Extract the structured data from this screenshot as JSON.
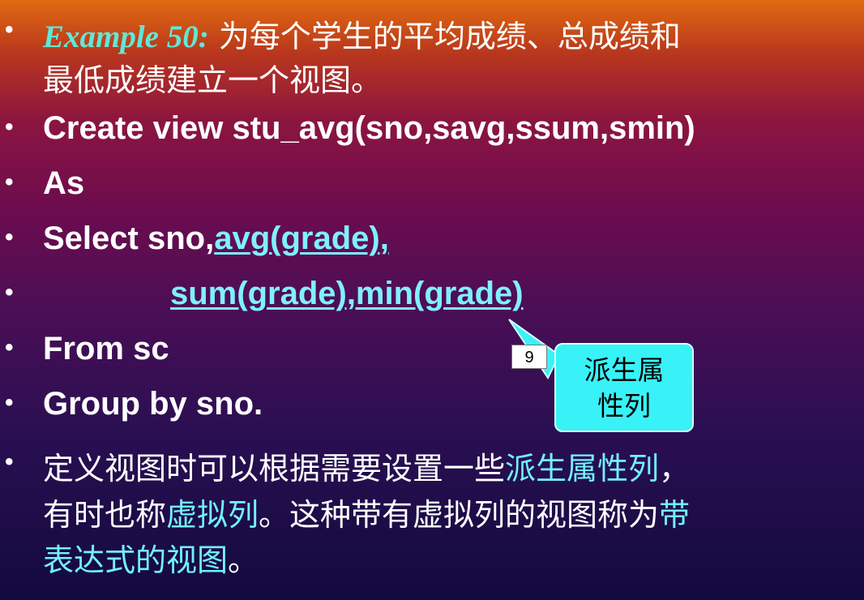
{
  "lines": {
    "l1_example": "Example 50:",
    "l1_cn": " 为每个学生的平均成绩、总成绩和",
    "l2_cn": "最低成绩建立一个视图。",
    "l3": "Create view stu_avg(sno,savg,ssum,smin)",
    "l4": "As",
    "l5_plain": "Select sno,",
    "l5_link": "avg(grade),",
    "l6_link": "sum(grade),min(grade)",
    "l7": "From sc",
    "l8": "Group by sno.",
    "l9_a": "定义视图时可以根据需要设置一些",
    "l9_hl": "派生属性列",
    "l9_b": "，",
    "l10_a": "有时也称",
    "l10_hl": "虚拟列",
    "l10_b": "。这种带有虚拟列的视图称为",
    "l10_hl2": "带",
    "l11_hl": "表达式的视图",
    "l11_b": "。"
  },
  "bullet_char": "•",
  "callout": {
    "line1": "派生属",
    "line2": "性列"
  },
  "slide_number": "9",
  "colors": {
    "accent_cyan": "#73f0ff",
    "example_teal": "#5fe8d8",
    "callout_fill": "#38f2f7"
  }
}
